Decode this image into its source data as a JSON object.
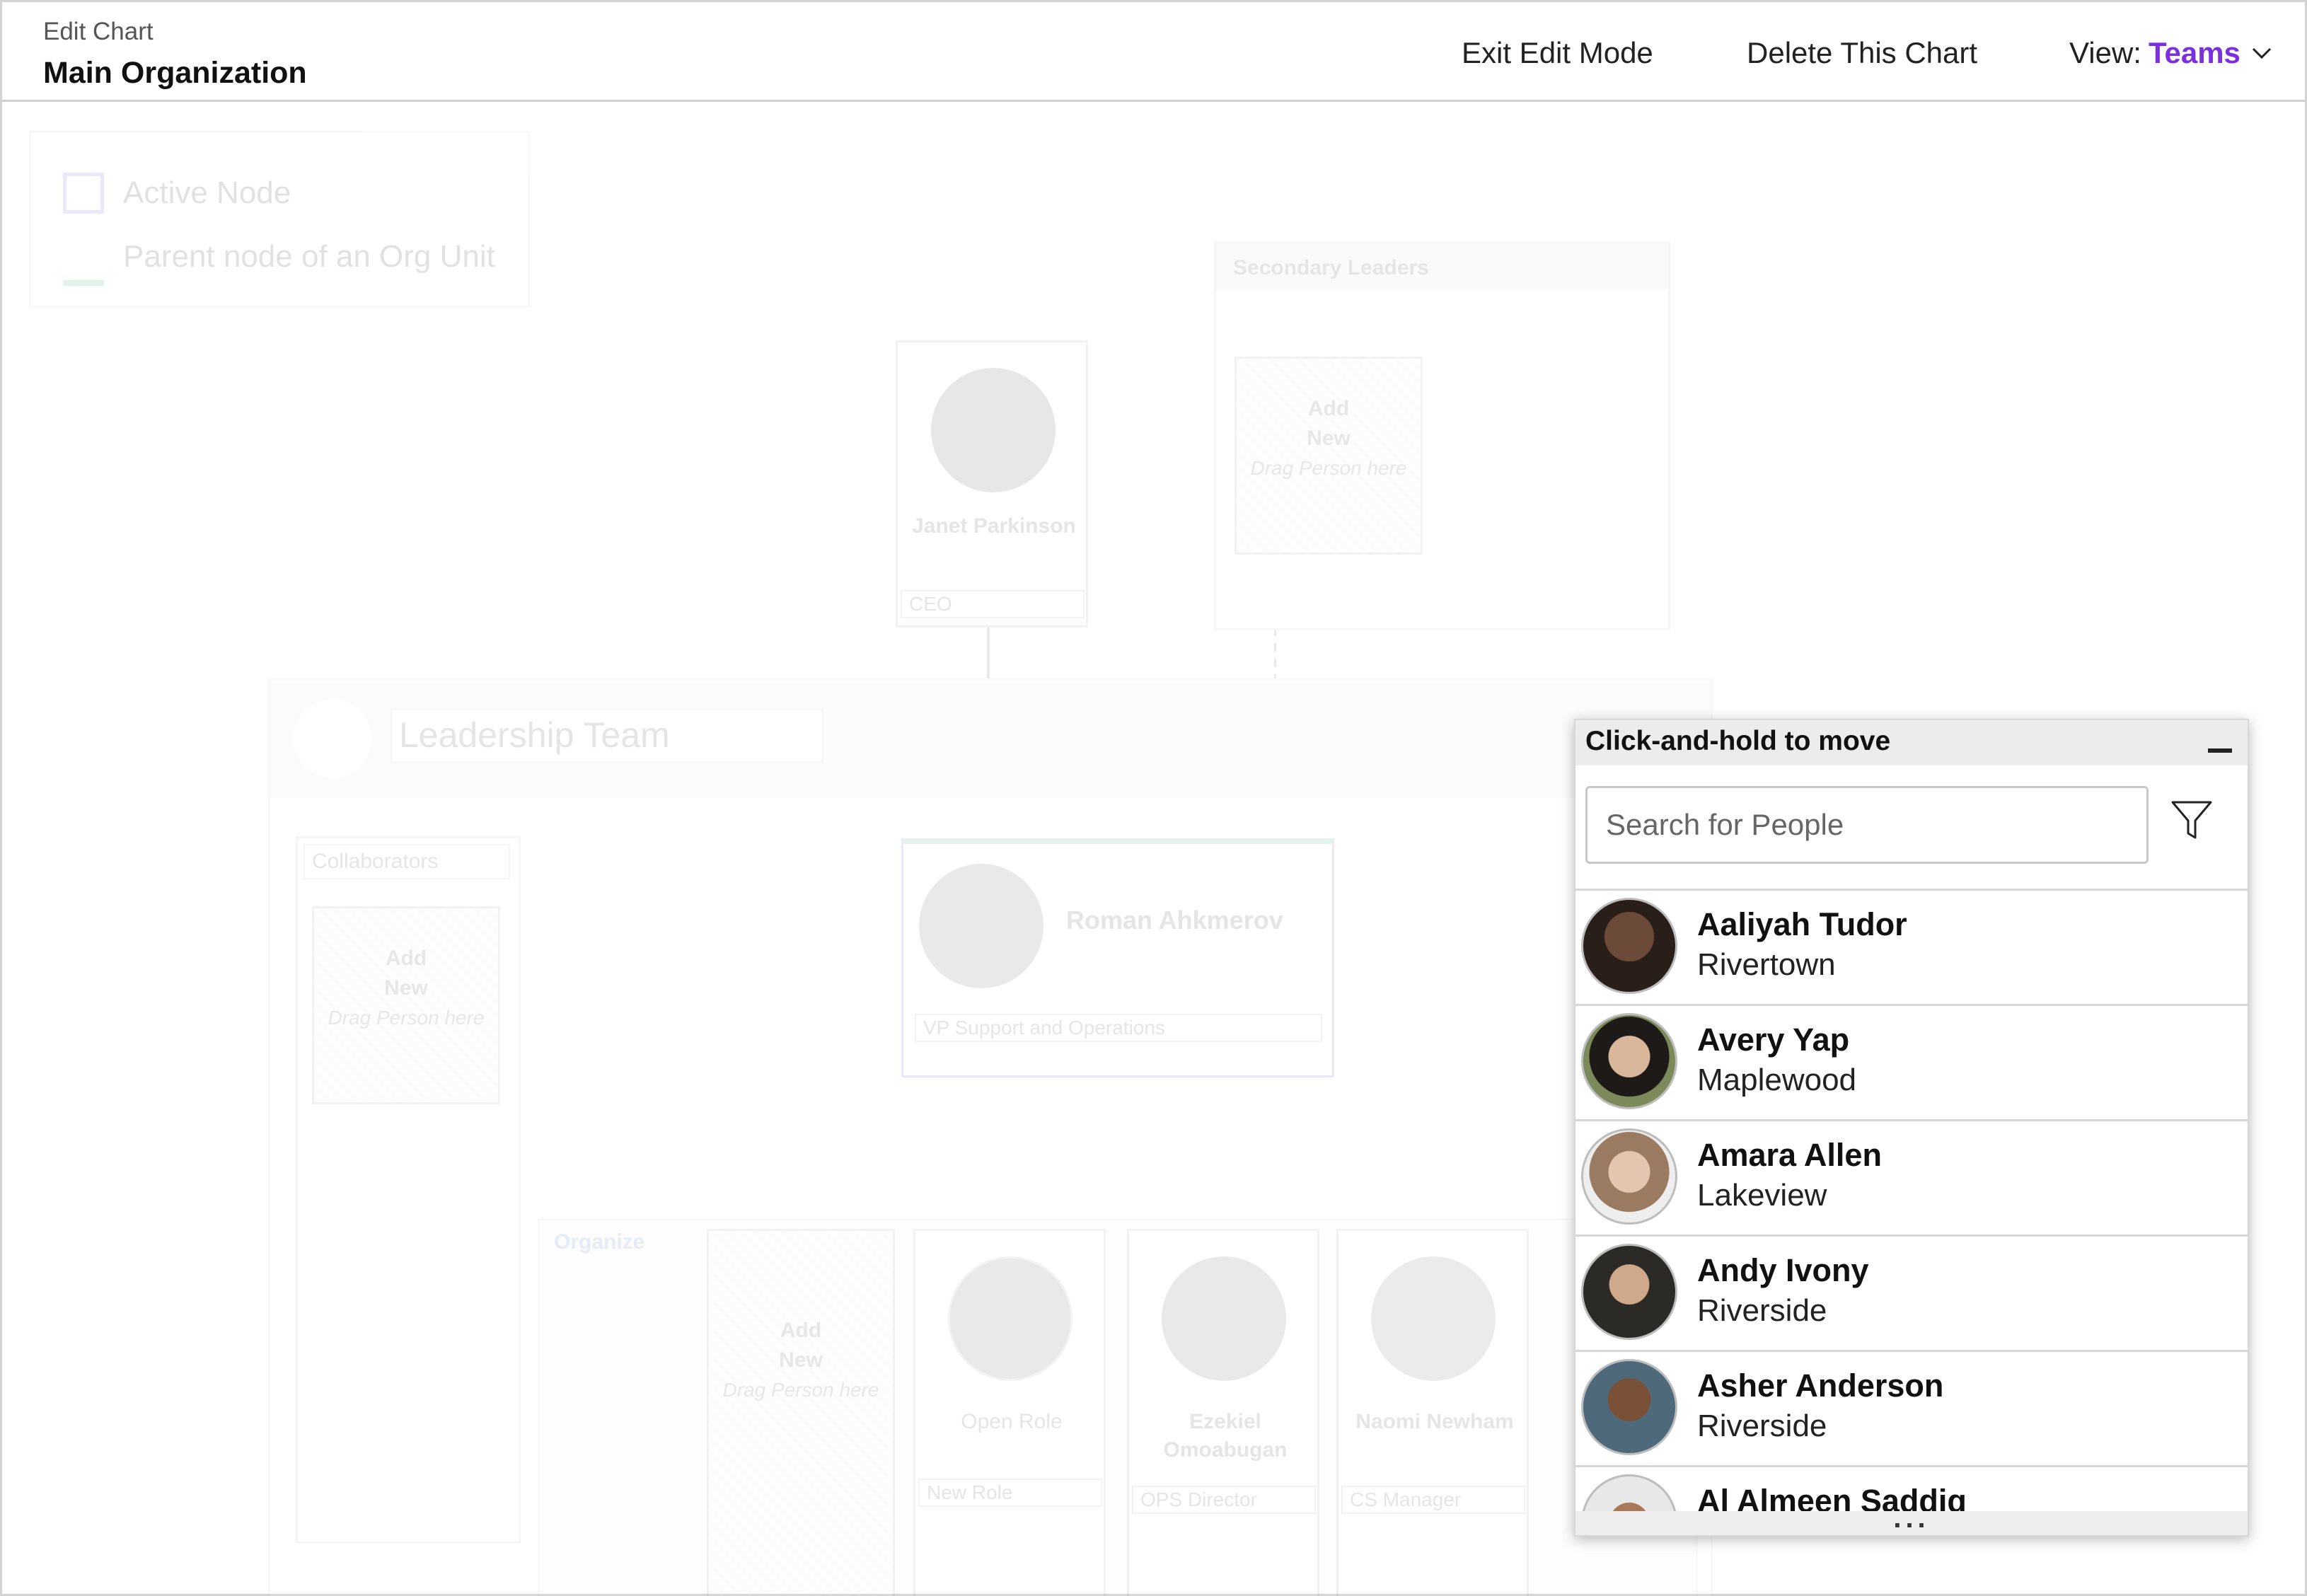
{
  "header": {
    "subtitle": "Edit Chart",
    "title": "Main Organization",
    "exit_edit": "Exit Edit Mode",
    "delete_chart": "Delete This Chart",
    "view_label": "View:",
    "view_value": "Teams"
  },
  "legend": {
    "active_node": "Active Node",
    "parent_node": "Parent node of an Org Unit"
  },
  "chart": {
    "secondary_leaders": "Secondary Leaders",
    "add_new": "Add\nNew",
    "drag_person": "Drag Person here",
    "ceo_name": "Janet Parkinson",
    "ceo_role": "CEO",
    "team_name": "Leadership Team",
    "collaborators": "Collaborators",
    "vp_name": "Roman Ahkmerov",
    "vp_role": "VP Support and Operations",
    "organize": "Organize",
    "open_role": "Open Role",
    "open_role_title": "New Role",
    "person3_name": "Ezekiel Omoabugan",
    "person3_role": "OPS Director",
    "person4_name": "Naomi Newham",
    "person4_role": "CS Manager"
  },
  "people_panel": {
    "title": "Click-and-hold to move",
    "search_placeholder": "Search for People",
    "people": [
      {
        "name": "Aaliyah Tudor",
        "location": "Rivertown"
      },
      {
        "name": "Avery Yap",
        "location": "Maplewood"
      },
      {
        "name": "Amara Allen",
        "location": "Lakeview"
      },
      {
        "name": "Andy Ivony",
        "location": "Riverside"
      },
      {
        "name": "Asher Anderson",
        "location": "Riverside"
      },
      {
        "name": "Al Almeen Saddiq",
        "location": ""
      }
    ],
    "more": "..."
  },
  "colors": {
    "accent": "#7b2fe0",
    "active_node": "#6f4bd6",
    "org_unit_parent": "#22a558"
  }
}
